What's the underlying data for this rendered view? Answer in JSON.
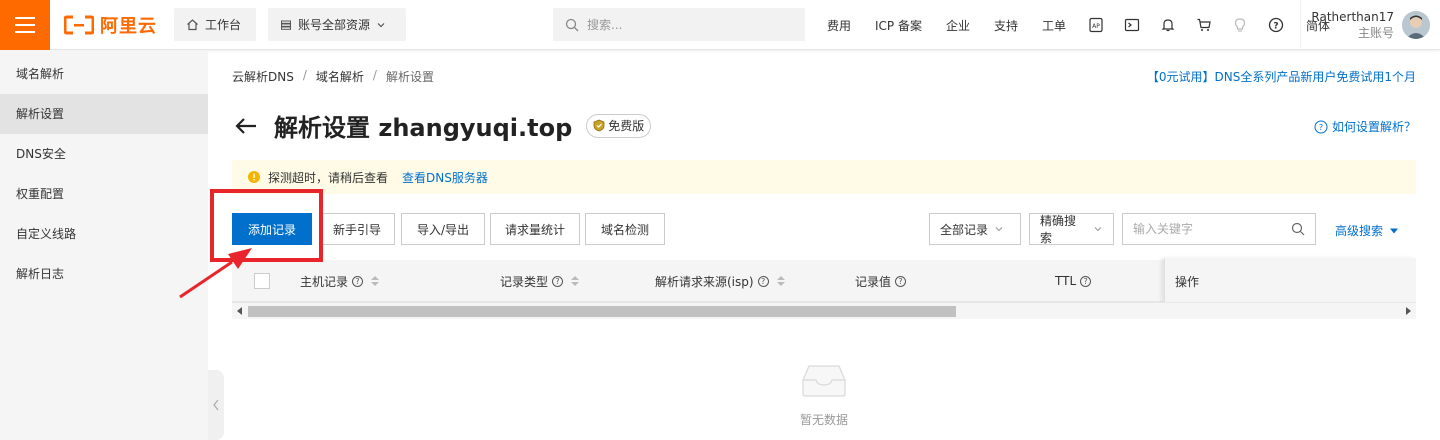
{
  "topbar": {
    "logo_text": "阿里云",
    "workbench_label": "工作台",
    "resources_label": "账号全部资源",
    "search_placeholder": "搜索...",
    "nav_links": [
      "费用",
      "ICP 备案",
      "企业",
      "支持",
      "工单"
    ],
    "lang_label": "简体",
    "user_name": "Ratherthan17",
    "user_role": "主账号",
    "icons": [
      "ap-icon",
      "terminal-icon",
      "bell-icon",
      "cart-icon",
      "bulb-icon",
      "help-icon"
    ]
  },
  "sidebar": {
    "items": [
      {
        "label": "域名解析",
        "active": false
      },
      {
        "label": "解析设置",
        "active": true
      },
      {
        "label": "DNS安全",
        "active": false
      },
      {
        "label": "权重配置",
        "active": false
      },
      {
        "label": "自定义线路",
        "active": false
      },
      {
        "label": "解析日志",
        "active": false
      }
    ]
  },
  "breadcrumb": [
    "云解析DNS",
    "域名解析",
    "解析设置"
  ],
  "promo_text": "【0元试用】DNS全系列产品新用户免费试用1个月",
  "page": {
    "title": "解析设置 zhangyuqi.top",
    "badge": "免费版",
    "help_link": "如何设置解析？"
  },
  "alert": {
    "message": "探测超时，请稍后查看",
    "link": "查看DNS服务器"
  },
  "toolbar": {
    "add_record": "添加记录",
    "guide": "新手引导",
    "import_export": "导入/导出",
    "request_stats": "请求量统计",
    "domain_check": "域名检测",
    "filter_select": "全部记录",
    "search_mode": "精确搜索",
    "keyword_placeholder": "输入关键字",
    "advanced_search": "高级搜索"
  },
  "table": {
    "columns": [
      "主机记录",
      "记录类型",
      "解析请求来源(isp)",
      "记录值",
      "TTL",
      "操作"
    ]
  },
  "empty_text": "暂无数据",
  "colors": {
    "brand": "#ff6a00",
    "primary": "#0070cc",
    "annotation": "#e8252b",
    "alert_bg": "#fffbe6"
  }
}
